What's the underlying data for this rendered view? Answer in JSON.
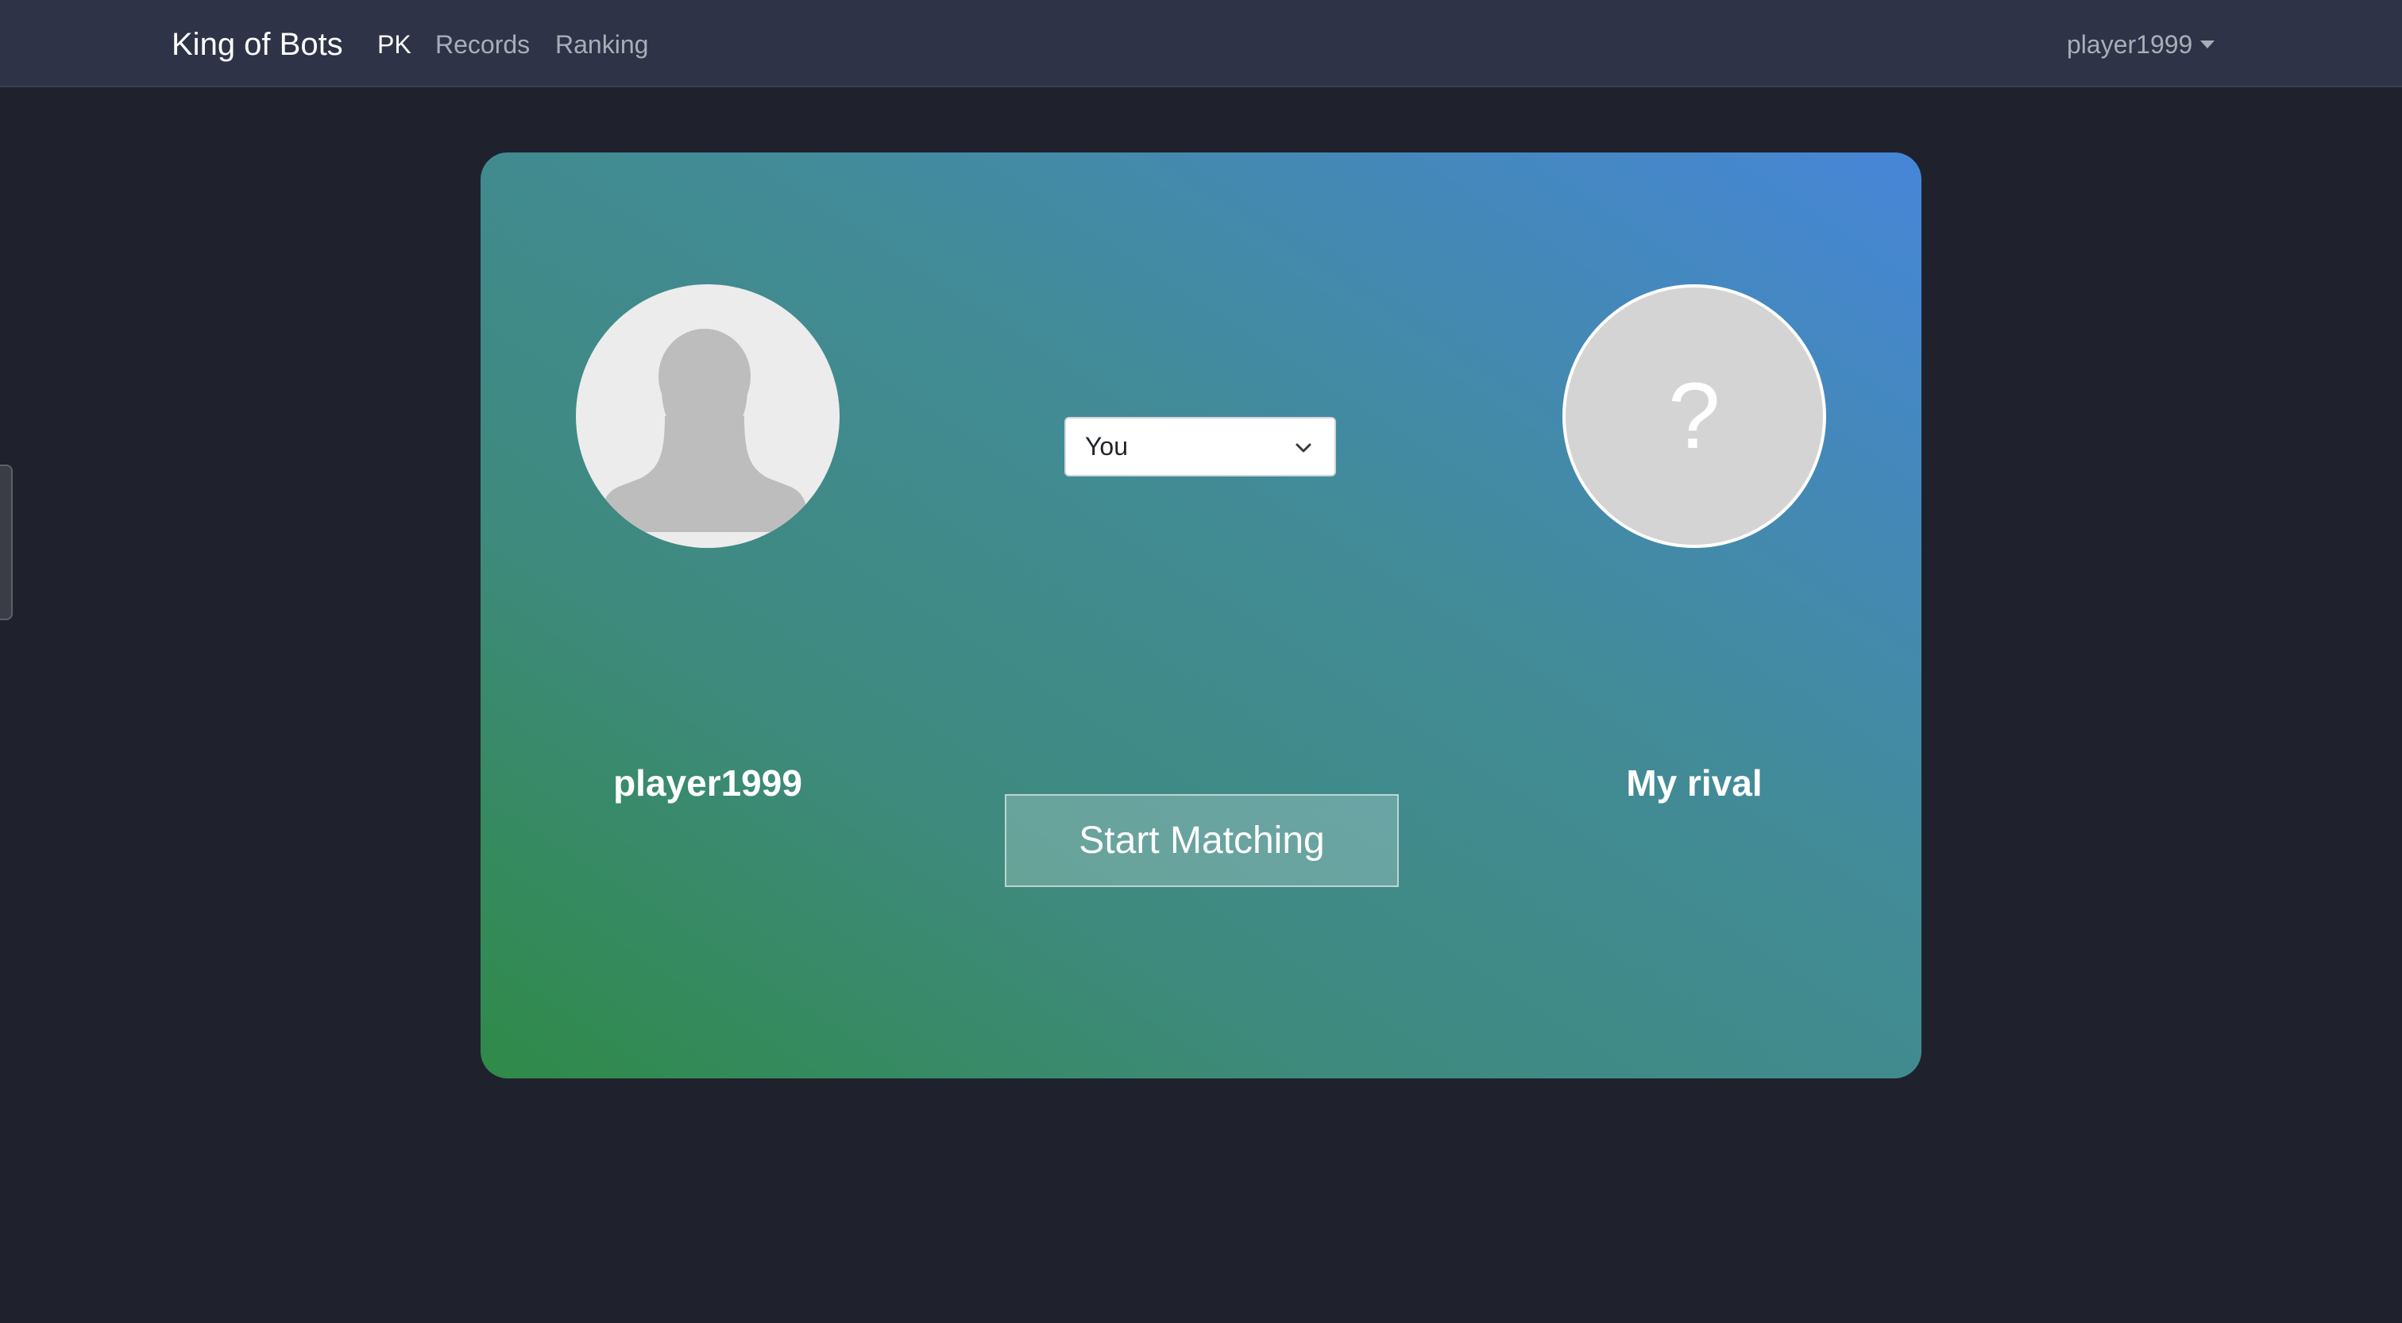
{
  "navbar": {
    "brand": "King of Bots",
    "links": [
      {
        "label": "PK",
        "active": true
      },
      {
        "label": "Records",
        "active": false
      },
      {
        "label": "Ranking",
        "active": false
      }
    ],
    "user_menu": {
      "label": "player1999",
      "icon": "caret-down-icon"
    }
  },
  "match": {
    "player": {
      "name": "player1999",
      "avatar_icon": "user-silhouette-icon"
    },
    "rival": {
      "name": "My rival",
      "avatar_glyph": "?"
    },
    "bot_select": {
      "selected": "You",
      "icon": "chevron-down-icon"
    },
    "start_button_label": "Start Matching"
  },
  "colors": {
    "page_bg": "#1f222d",
    "navbar_bg": "#2e3347",
    "gradient_start": "#2f8a48",
    "gradient_end": "#4686d8"
  }
}
